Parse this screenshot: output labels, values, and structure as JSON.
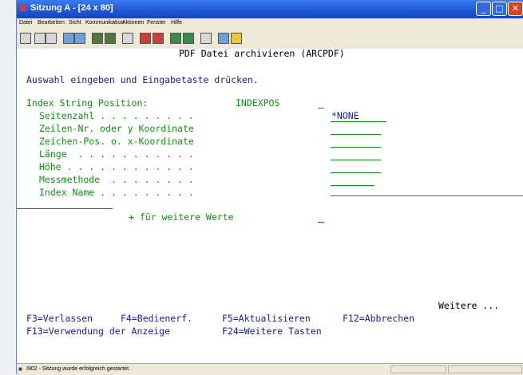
{
  "window": {
    "title": "Sitzung A - [24 x 80]"
  },
  "menu": [
    "Datei",
    "Bearbeiten",
    "Sicht",
    "Kommunikation",
    "Aktionen",
    "Fenster",
    "Hilfe"
  ],
  "toolbar_icons": [
    "print-screen-icon",
    "copy-icon",
    "paste-icon",
    "send-icon",
    "receive-icon",
    "display-icon",
    "keypad-icon",
    "macro-icon",
    "record-macro-icon",
    "play-macro-icon",
    "stop-macro-icon",
    "pause-macro-icon",
    "clipboard-icon",
    "color-icon",
    "help-icon"
  ],
  "screen": {
    "title": "PDF Datei archivieren (ARCPDF)",
    "instruction": "Auswahl eingeben und Eingabetaste drücken.",
    "param_label": "Index String Position:",
    "param_keyword": "INDEXPOS",
    "fields": [
      {
        "label": "Seitenzahl . . . . . . . . .",
        "value": "*NONE"
      },
      {
        "label": "Zeilen-Nr. oder y Koordinate",
        "value": ""
      },
      {
        "label": "Zeichen-Pos. o. x-Koordinate",
        "value": ""
      },
      {
        "label": "Länge  . . . . . . . . . . .",
        "value": ""
      },
      {
        "label": "Höhe . . . . . . . . . . . .",
        "value": ""
      },
      {
        "label": "Messmethode  . . . . . . . .",
        "value": ""
      },
      {
        "label": "Index Name . . . . . . . . .",
        "value": ""
      }
    ],
    "more_values": "+ für weitere Werte",
    "more": "Weitere ...",
    "fkeys_row1": [
      "F3=Verlassen",
      "F4=Bedienerf.",
      "F5=Aktualisieren",
      "F12=Abbrechen"
    ],
    "fkeys_row2": [
      "F13=Verwendung der Anzeige",
      "F24=Weitere Tasten"
    ]
  },
  "status": {
    "message": "I902 - Sitzung wurde erfolgreich gestartet."
  },
  "colors": {
    "text_blue": "#1a1aa6",
    "text_green": "#109010",
    "titlebar": "#1a55d6"
  }
}
